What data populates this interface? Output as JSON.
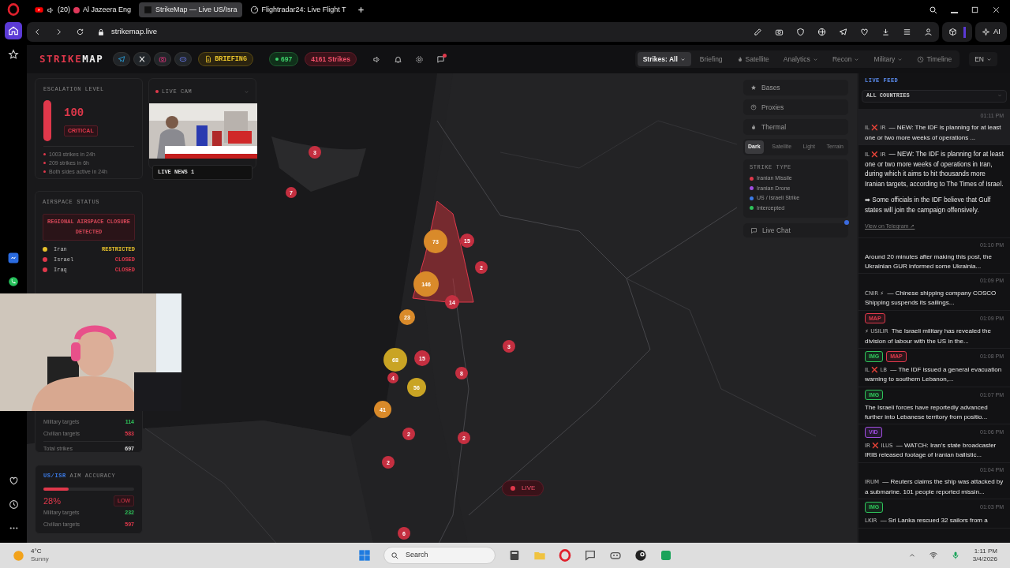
{
  "browser": {
    "sidebar": [
      {
        "kind": "home",
        "selected": true
      },
      {
        "kind": "star",
        "selected": false
      },
      {
        "kind": "messenger",
        "selected": false
      },
      {
        "kind": "whatsapp",
        "selected": false
      }
    ],
    "sidebar_bottom": [
      {
        "kind": "heart"
      },
      {
        "kind": "clock"
      },
      {
        "kind": "dots"
      }
    ],
    "tabs": [
      {
        "kind": "youtube",
        "badge": "(20)",
        "title": "Al Jazeera Eng",
        "selected": false
      },
      {
        "kind": "site",
        "title": "StrikeMap — Live US/Isra",
        "selected": true
      },
      {
        "kind": "radar",
        "title": "Flightradar24: Live Flight T",
        "selected": false
      }
    ],
    "address": "strikemap.live",
    "ai_label": "AI"
  },
  "header": {
    "logo_accent": "STRIKE",
    "logo_rest": "MAP",
    "socials": [
      {
        "kind": "plane"
      },
      {
        "kind": "x"
      },
      {
        "kind": "camera"
      },
      {
        "kind": "gamepad"
      }
    ],
    "briefing": "BRIEFING",
    "count": "697",
    "strikes": "4161 Strikes",
    "nav": [
      {
        "label": "Strikes: All",
        "selected": true,
        "dropdown": true,
        "kind": "plain"
      },
      {
        "label": "Briefing",
        "selected": false,
        "dropdown": false,
        "kind": "plain"
      },
      {
        "label": "Satellite",
        "selected": false,
        "dropdown": false,
        "kind": "thermal"
      },
      {
        "label": "Analytics",
        "selected": false,
        "dropdown": true,
        "kind": "plain"
      },
      {
        "label": "Recon",
        "selected": false,
        "dropdown": true,
        "kind": "plain"
      },
      {
        "label": "Military",
        "selected": false,
        "dropdown": true,
        "kind": "plain"
      },
      {
        "label": "Timeline",
        "selected": false,
        "dropdown": false,
        "kind": "history"
      }
    ],
    "language": "EN"
  },
  "escalation": {
    "title": "ESCALATION LEVEL",
    "level": 1,
    "value": "100",
    "severity": "CRITICAL",
    "facts": [
      "1003 strikes in 24h",
      "209 strikes in 6h",
      "Both sides active in 24h"
    ]
  },
  "airspace": {
    "title": "AIRSPACE STATUS",
    "alert": "REGIONAL AIRSPACE CLOSURE DETECTED",
    "rows": [
      {
        "country": "Iran",
        "status": "RESTRICTED",
        "color": "#e6c12b"
      },
      {
        "country": "Israel",
        "status": "CLOSED",
        "color": "#e0384b"
      },
      {
        "country": "Iraq",
        "status": "CLOSED",
        "color": "#e0384b"
      }
    ]
  },
  "targets": {
    "rows": [
      {
        "label": "Military targets",
        "value": "114",
        "kind": "good"
      },
      {
        "label": "Civilian targets",
        "value": "583",
        "kind": "bad"
      },
      {
        "label": "Total strikes",
        "value": "697",
        "kind": "total"
      }
    ]
  },
  "accuracy": {
    "title_accent": "US/ISR",
    "title": "AIM ACCURACY",
    "level": 0.28,
    "value": "28%",
    "rating": "LOW",
    "rows": [
      {
        "label": "Military targets",
        "value": "232",
        "kind": "good"
      },
      {
        "label": "Civilian targets",
        "value": "597",
        "kind": "bad"
      }
    ]
  },
  "live_cam": {
    "title": "LIVE CAM",
    "channel": "LIVE NEWS 1"
  },
  "layers": [
    {
      "label": "Bases",
      "kind": "star"
    },
    {
      "label": "Proxies",
      "kind": "pin"
    },
    {
      "label": "Thermal",
      "kind": "flame"
    }
  ],
  "map_styles": [
    {
      "label": "Dark",
      "selected": true
    },
    {
      "label": "Satellite",
      "selected": false
    },
    {
      "label": "Light",
      "selected": false
    },
    {
      "label": "Terrain",
      "selected": false
    }
  ],
  "legend": {
    "title": "STRIKE TYPE",
    "items": [
      {
        "label": "Iranian Missile",
        "color": "#e0384b"
      },
      {
        "label": "Iranian Drone",
        "color": "#a04de0"
      },
      {
        "label": "US / Israeli Strike",
        "color": "#3b7be8"
      },
      {
        "label": "Intercepted",
        "color": "#2ec45a"
      }
    ]
  },
  "live_chat": "Live Chat",
  "live": "LIVE",
  "markers": [
    {
      "label": "3",
      "color": "#c42f40"
    },
    {
      "label": "7",
      "color": "#c42f40"
    },
    {
      "label": "73",
      "color": "#d98a2a"
    },
    {
      "label": "15",
      "color": "#c42f40"
    },
    {
      "label": "2",
      "color": "#c42f40"
    },
    {
      "label": "146",
      "color": "#d98a2a"
    },
    {
      "label": "14",
      "color": "#c42f40"
    },
    {
      "label": "23",
      "color": "#d98a2a"
    },
    {
      "label": "3",
      "color": "#c42f40"
    },
    {
      "label": "68",
      "color": "#c9a424"
    },
    {
      "label": "15",
      "color": "#c42f40"
    },
    {
      "label": "4",
      "color": "#c42f40"
    },
    {
      "label": "8",
      "color": "#c42f40"
    },
    {
      "label": "56",
      "color": "#c9a424"
    },
    {
      "label": "41",
      "color": "#d98a2a"
    },
    {
      "label": "2",
      "color": "#c42f40"
    },
    {
      "label": "2",
      "color": "#c42f40"
    },
    {
      "label": "2",
      "color": "#c42f40"
    },
    {
      "label": "6",
      "color": "#c42f40"
    }
  ],
  "feed": {
    "title": "LIVE FEED",
    "filter": "ALL COUNTRIES",
    "items": [
      {
        "time": "01:11 PM",
        "selected": true,
        "prefix": "IL ❌ IR",
        "text": "— NEW: The IDF is planning for at least one or two more weeks of operations ...",
        "detail": {
          "prefix": "IL ❌ IR",
          "text": "— NEW: The IDF is planning for at least one or two more weeks of operations in Iran, during which it aims to hit thousands more Iranian targets, according to The Times of Israel.",
          "note": "➡ Some officials in the IDF believe that Gulf states will join the campaign offensively.",
          "link": "View on Telegram ↗"
        }
      },
      {
        "time": "01:10 PM",
        "selected": false,
        "text": "Around 20 minutes after making this post, the Ukrainian GUR informed some Ukrainia..."
      },
      {
        "time": "01:09 PM",
        "selected": false,
        "prefix": "CNIR ⚡",
        "text": "— Chinese shipping company COSCO Shipping suspends its sailings..."
      },
      {
        "time": "01:09 PM",
        "selected": false,
        "badges": [
          {
            "label": "MAP",
            "color": "#e0384b"
          }
        ],
        "prefix": "⚡ USILIR",
        "text": "The Israeli military has revealed the division of labour with the US in the..."
      },
      {
        "time": "01:08 PM",
        "selected": false,
        "badges": [
          {
            "label": "IMG",
            "color": "#2ec45a"
          },
          {
            "label": "MAP",
            "color": "#e0384b"
          }
        ],
        "prefix": "IL ❌ LB",
        "text": "— The IDF issued a general evacuation warning to southern Lebanon,..."
      },
      {
        "time": "01:07 PM",
        "selected": false,
        "badges": [
          {
            "label": "IMG",
            "color": "#2ec45a"
          }
        ],
        "text": "The Israeli forces have reportedly advanced further into Lebanese territory from positio..."
      },
      {
        "time": "01:06 PM",
        "selected": false,
        "badges": [
          {
            "label": "VID",
            "color": "#a04de0"
          }
        ],
        "prefix": "IR ❌ ILUS",
        "text": "— WATCH: Iran's state broadcaster IRIB released footage of Iranian ballistic..."
      },
      {
        "time": "01:04 PM",
        "selected": false,
        "prefix": "IRUM",
        "text": "— Reuters claims the ship was attacked by a submarine. 101 people reported missin..."
      },
      {
        "time": "01:03 PM",
        "selected": false,
        "badges": [
          {
            "label": "IMG",
            "color": "#2ec45a"
          }
        ],
        "prefix": "LKIR",
        "text": "— Sri Lanka rescued 32 sailors from a"
      }
    ]
  },
  "taskbar": {
    "temperature": "4°C",
    "condition": "Sunny",
    "search": "Search",
    "apps": [
      {
        "kind": "files"
      },
      {
        "kind": "folder"
      },
      {
        "kind": "opera"
      },
      {
        "kind": "chat"
      },
      {
        "kind": "gamepad"
      },
      {
        "kind": "steam"
      },
      {
        "kind": "app"
      }
    ],
    "time": "1:11 PM",
    "date": "3/4/2026"
  }
}
